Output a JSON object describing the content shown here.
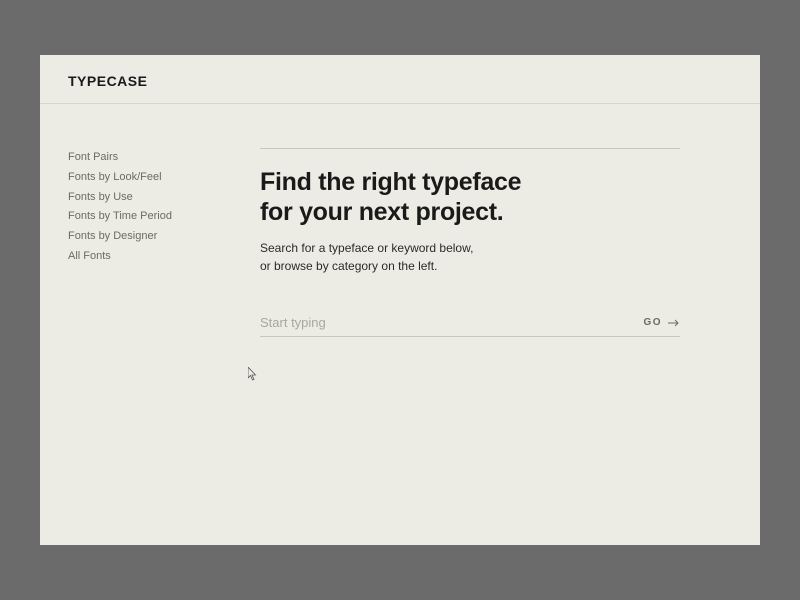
{
  "header": {
    "logo": "TYPECASE"
  },
  "sidebar": {
    "items": [
      {
        "label": "Font Pairs"
      },
      {
        "label": "Fonts by Look/Feel"
      },
      {
        "label": "Fonts by Use"
      },
      {
        "label": "Fonts by Time Period"
      },
      {
        "label": "Fonts by Designer"
      },
      {
        "label": "All Fonts"
      }
    ]
  },
  "main": {
    "title_line1": "Find the right typeface",
    "title_line2": "for your next project.",
    "sub_line1": "Search for a typeface or keyword below,",
    "sub_line2": "or browse by category on the left.",
    "search_placeholder": "Start typing",
    "go_label": "GO"
  }
}
